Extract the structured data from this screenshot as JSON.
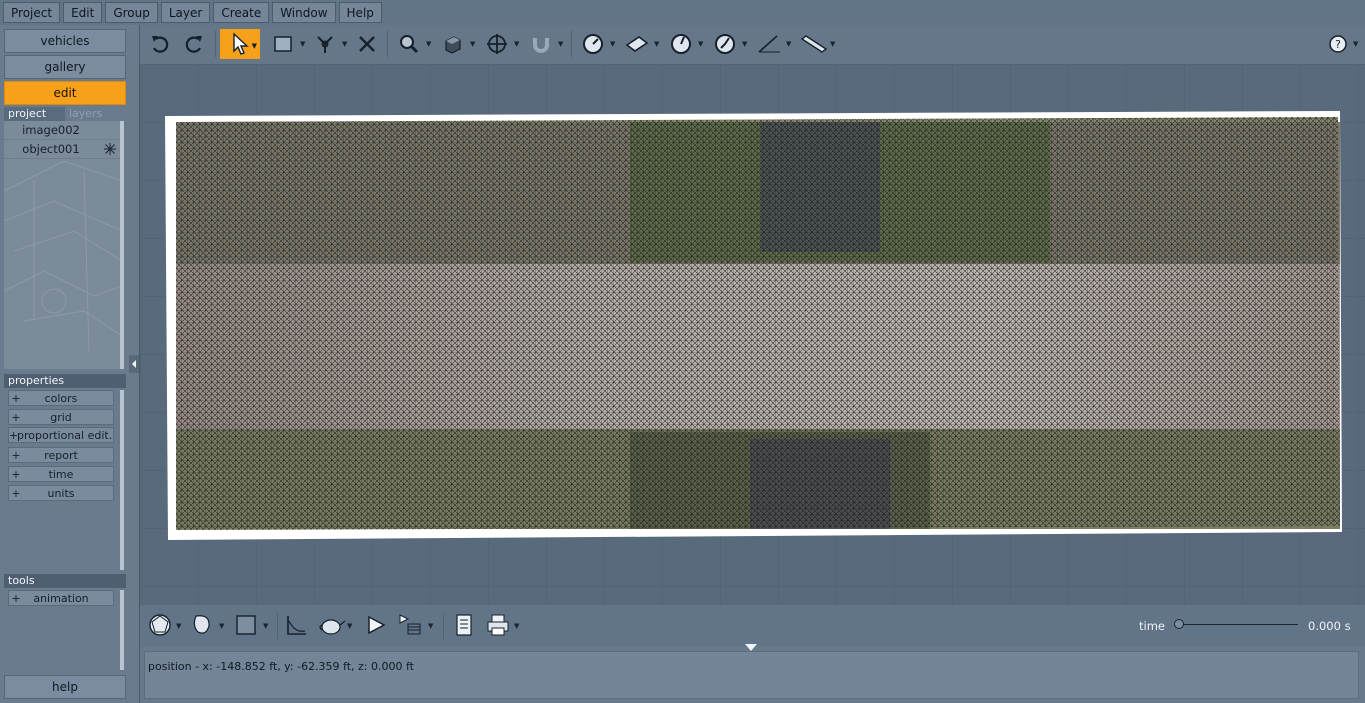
{
  "menu": [
    "Project",
    "Edit",
    "Group",
    "Layer",
    "Create",
    "Window",
    "Help"
  ],
  "nav": {
    "vehicles": "vehicles",
    "gallery": "gallery",
    "edit": "edit"
  },
  "tabs": {
    "project": "project",
    "layers": "layers"
  },
  "project_items": [
    {
      "name": "image002"
    },
    {
      "name": "object001",
      "icon": "snowflake-icon"
    }
  ],
  "properties": {
    "header": "properties",
    "items": [
      "colors",
      "grid",
      "proportional edit...",
      "report",
      "time",
      "units"
    ]
  },
  "tools": {
    "header": "tools",
    "items": [
      "animation"
    ]
  },
  "help_label": "help",
  "timeline": {
    "label": "time",
    "value": "0.000 s",
    "progress": 0
  },
  "status": {
    "text": "position - x: -148.852 ft, y: -62.359 ft, z: 0.000 ft"
  },
  "colors": {
    "accent": "#f7a11a",
    "panel": "#6a7b8e",
    "viewport": "#5a6a7c"
  },
  "icons": [
    "undo-icon",
    "redo-icon",
    "select-arrow-icon",
    "rectangle-select-icon",
    "axis-gizmo-icon",
    "scissors-icon",
    "zoom-icon",
    "cube-view-icon",
    "move-icon",
    "magnet-icon",
    "measure-dial-icon",
    "plane-icon",
    "gauge-icon",
    "angle-icon",
    "ruler-icon",
    "tape-icon",
    "help-circle-icon"
  ]
}
